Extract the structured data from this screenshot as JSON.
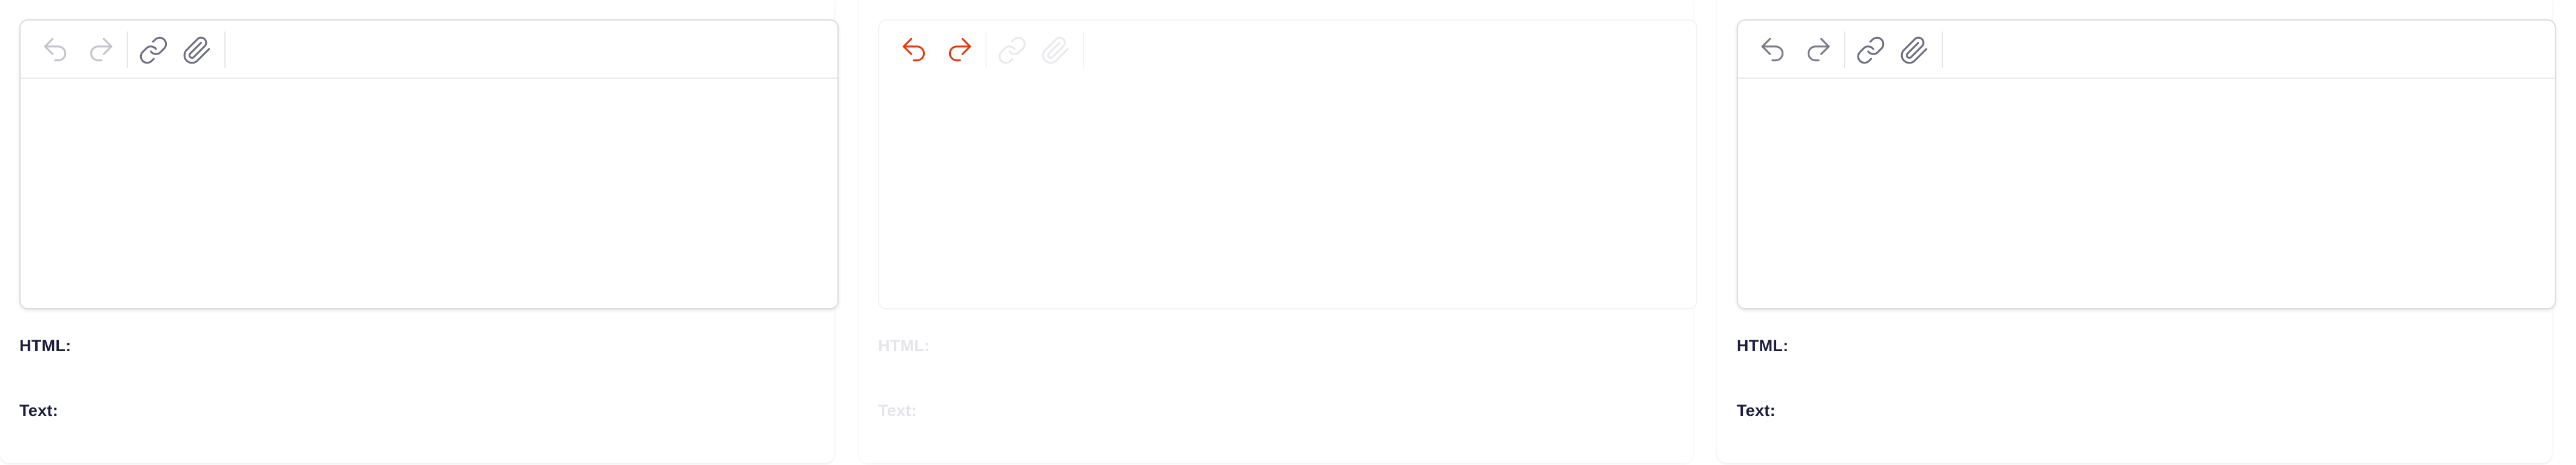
{
  "editors": [
    {
      "toolbar": {
        "undo_icon": "undo-icon",
        "redo_icon": "redo-icon",
        "link_icon": "link-icon",
        "attach_icon": "paperclip-icon"
      },
      "outputs": {
        "html_label": "HTML:",
        "text_label": "Text:"
      },
      "state": "enabled-history-empty"
    },
    {
      "toolbar": {
        "undo_icon": "undo-icon",
        "redo_icon": "redo-icon",
        "link_icon": "link-icon",
        "attach_icon": "paperclip-icon"
      },
      "outputs": {
        "html_label": "HTML:",
        "text_label": "Text:"
      },
      "state": "disabled-with-active-history"
    },
    {
      "toolbar": {
        "undo_icon": "undo-icon",
        "redo_icon": "redo-icon",
        "link_icon": "link-icon",
        "attach_icon": "paperclip-icon"
      },
      "outputs": {
        "html_label": "HTML:",
        "text_label": "Text:"
      },
      "state": "enabled"
    }
  ],
  "colors": {
    "accent_active": "#e03b12",
    "label_text": "#1c1d3d",
    "icon_muted": "#c4c4cb",
    "icon_default": "#6e6e82"
  }
}
